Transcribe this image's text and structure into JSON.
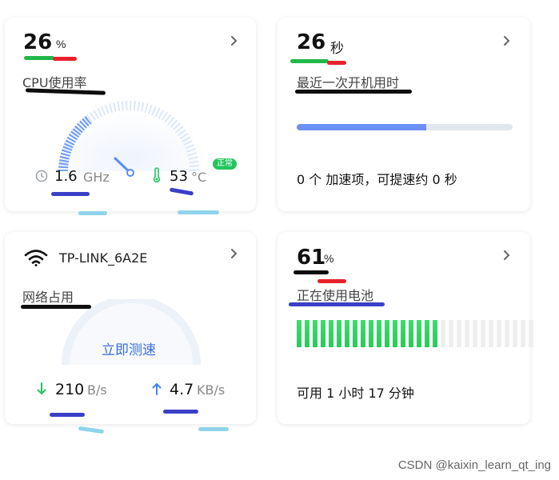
{
  "cpu_card": {
    "value": "26",
    "unit": "%",
    "label": "CPU使用率",
    "freq_value": "1.6",
    "freq_unit": "GHz",
    "temp_value": "53",
    "temp_unit": "°C",
    "temp_badge": "正常",
    "gauge_level_percent": 26
  },
  "boot_card": {
    "value": "26",
    "unit": "秒",
    "label": "最近一次开机用时",
    "progress_percent": 60,
    "summary": "0 个 加速项，可提速约 0 秒"
  },
  "network_card": {
    "ssid": "TP-LINK_6A2E",
    "label": "网络占用",
    "speed_test_label": "立即测速",
    "down_value": "210",
    "down_unit": "B/s",
    "up_value": "4.7",
    "up_unit": "KB/s"
  },
  "battery_card": {
    "value": "61",
    "unit": "%",
    "label": "正在使用电池",
    "segments_total": 30,
    "segments_on": 18,
    "remaining": "可用 1 小时 17 分钟"
  },
  "watermark": "CSDN @kaixin_learn_qt_ing",
  "colors": {
    "accent_blue": "#6b8ff7",
    "green": "#22c55e",
    "annotation_green": "#1fb84a",
    "annotation_red": "#e8202a",
    "annotation_black": "#0d0d0d",
    "annotation_blue": "#3a3fc8",
    "annotation_cyan": "#8fd4ea"
  }
}
